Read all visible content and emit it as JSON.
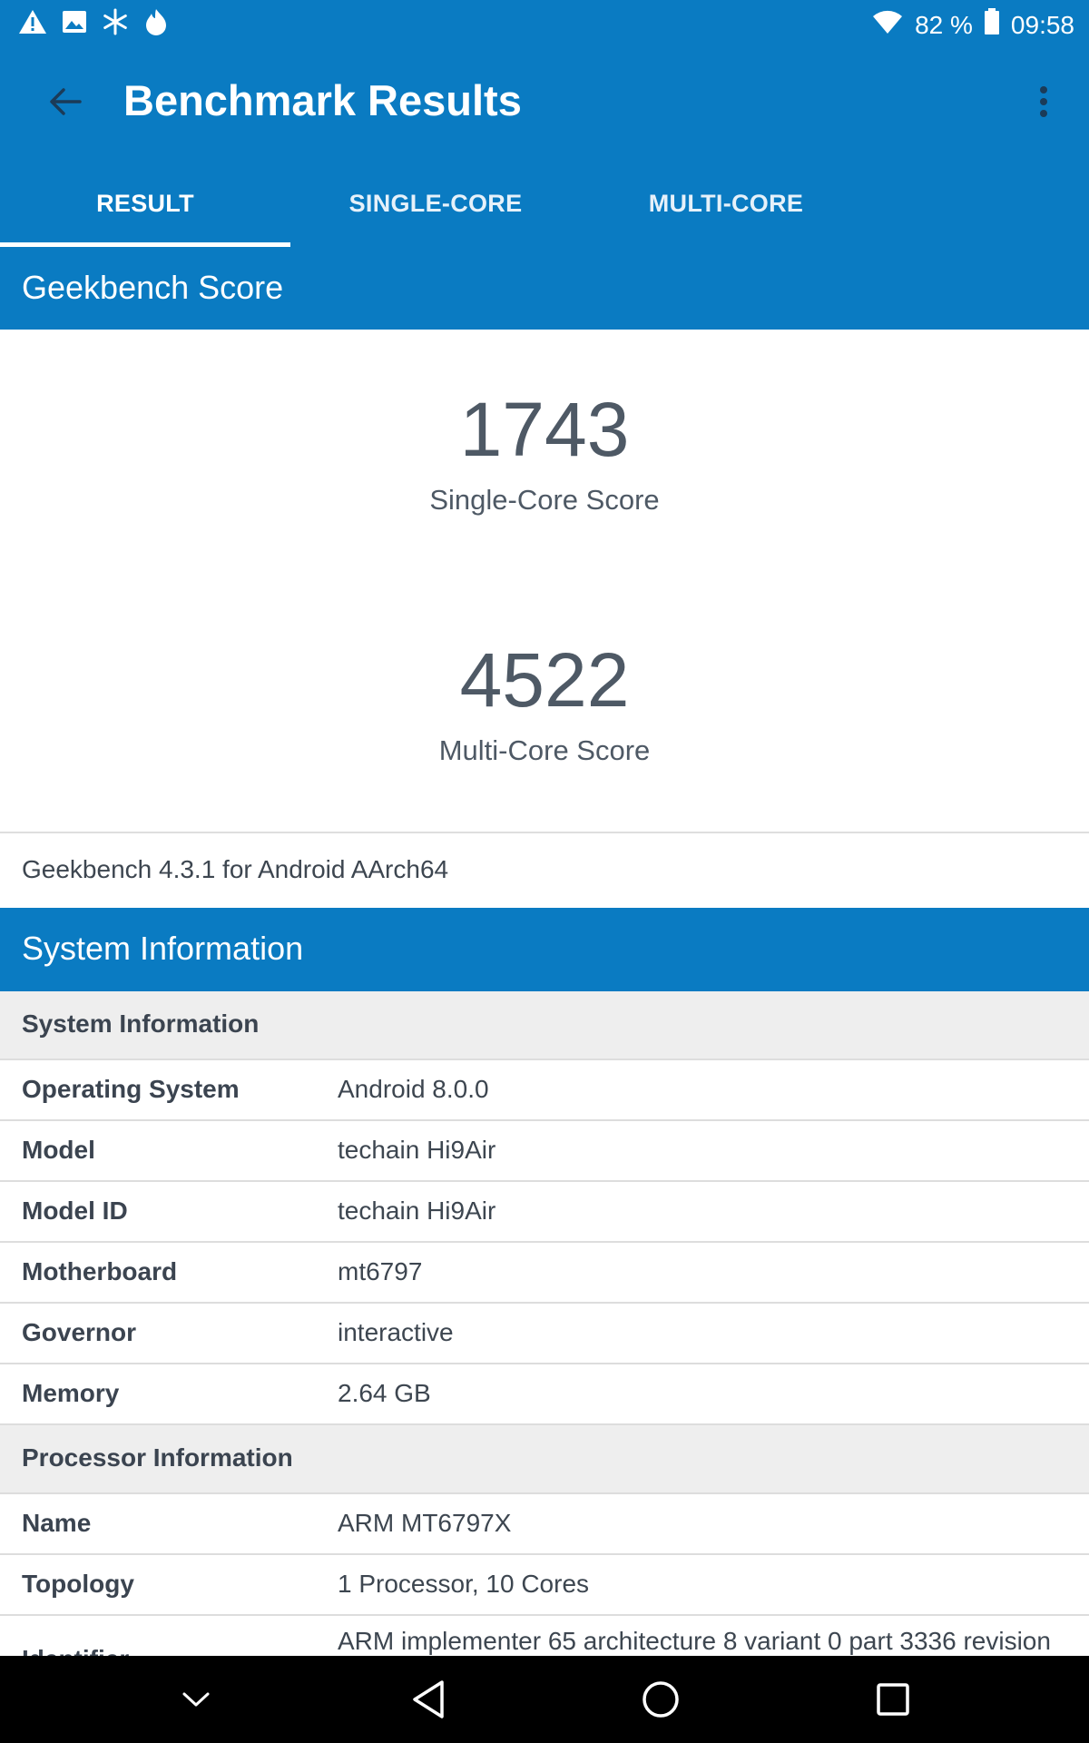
{
  "status_bar": {
    "icons_left": [
      "warning-icon",
      "image-icon",
      "snowflake-icon",
      "flame-icon"
    ],
    "battery": "82 %",
    "time": "09:58"
  },
  "app_bar": {
    "title": "Benchmark Results"
  },
  "tabs": [
    {
      "label": "RESULT",
      "active": true
    },
    {
      "label": "SINGLE-CORE",
      "active": false
    },
    {
      "label": "MULTI-CORE",
      "active": false
    }
  ],
  "geekbench_section": {
    "title": "Geekbench Score",
    "single_core_value": "1743",
    "single_core_label": "Single-Core Score",
    "multi_core_value": "4522",
    "multi_core_label": "Multi-Core Score",
    "version": "Geekbench 4.3.1 for Android AArch64"
  },
  "system_section": {
    "title": "System Information",
    "group1": "System Information",
    "rows1": [
      {
        "key": "Operating System",
        "value": "Android 8.0.0"
      },
      {
        "key": "Model",
        "value": "techain Hi9Air"
      },
      {
        "key": "Model ID",
        "value": "techain Hi9Air"
      },
      {
        "key": "Motherboard",
        "value": "mt6797"
      },
      {
        "key": "Governor",
        "value": "interactive"
      },
      {
        "key": "Memory",
        "value": "2.64 GB"
      }
    ],
    "group2": "Processor Information",
    "rows2": [
      {
        "key": "Name",
        "value": "ARM MT6797X"
      },
      {
        "key": "Topology",
        "value": "1 Processor, 10 Cores"
      },
      {
        "key": "Identifier",
        "value": "ARM implementer 65 architecture 8 variant 0 part 3336 revision"
      }
    ]
  },
  "colors": {
    "primary": "#0a7bc2",
    "score_text": "#4e5965",
    "group_bg": "#eeeeee"
  }
}
